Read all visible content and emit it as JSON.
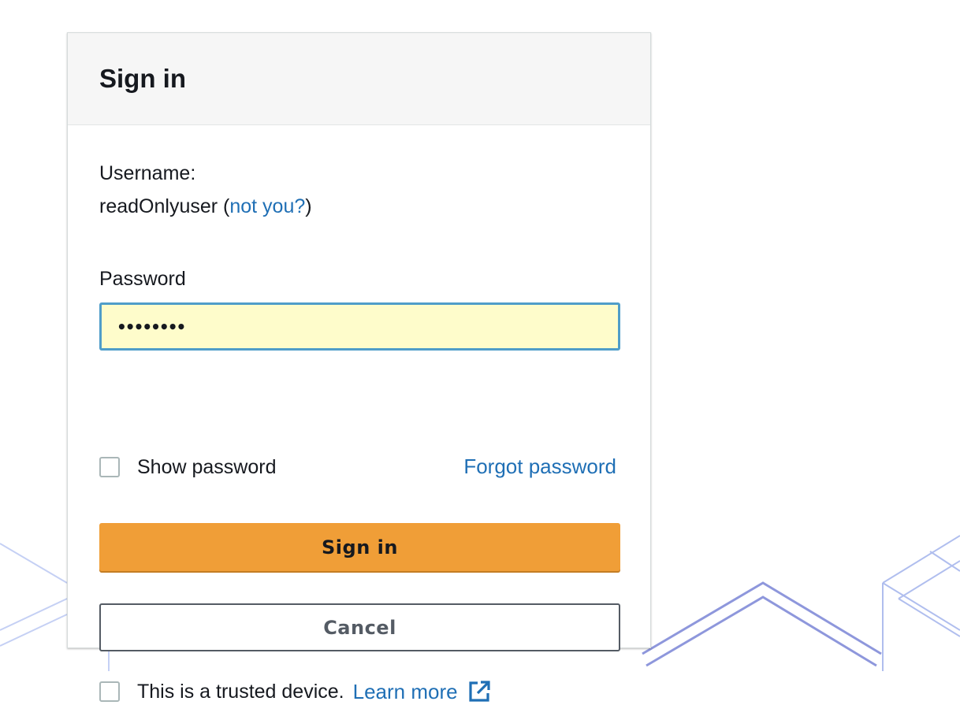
{
  "signin_card": {
    "title": "Sign in",
    "username_label": "Username:",
    "username_value": "readOnlyuser",
    "not_you_link": "not you?",
    "password_label": "Password",
    "password_value": "••••••••",
    "show_password_label": "Show password",
    "forgot_password_link": "Forgot password",
    "signin_button": "Sign in",
    "cancel_button": "Cancel",
    "trusted_device_label": "This is a trusted device.",
    "learn_more_link": "Learn more",
    "learn_more_icon": "external-link-icon"
  },
  "colors": {
    "primary_button": "#f09e37",
    "link": "#1f6fb5",
    "input_background": "#fefccb",
    "input_focus_border": "#4f9dc9"
  }
}
